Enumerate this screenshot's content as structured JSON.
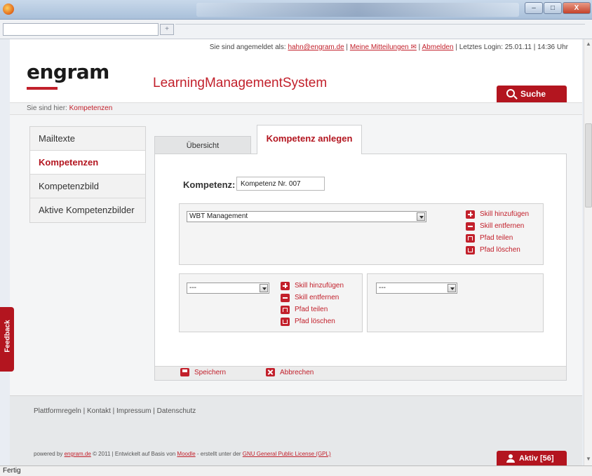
{
  "window": {
    "minimize": "–",
    "maximize": "□",
    "close": "X",
    "new_tab": "+"
  },
  "header": {
    "logged_in_prefix": "Sie sind angemeldet als: ",
    "user_email": "hahn@engram.de",
    "sep1": " | ",
    "messages": "Meine Mitteilungen ✉",
    "sep2": " | ",
    "logout": "Abmelden",
    "last_login": " | Letztes Login: 25.01.11 | 14:36 Uhr",
    "logo": "engram",
    "app_title": "LearningManagementSystem",
    "search_label": "Suche"
  },
  "breadcrumb": {
    "prefix": "Sie sind hier: ",
    "current": "Kompetenzen"
  },
  "sidebar": {
    "items": [
      {
        "label": "Mailtexte"
      },
      {
        "label": "Kompetenzen"
      },
      {
        "label": "Kompetenzbild"
      },
      {
        "label": "Aktive Kompetenzbilder"
      }
    ]
  },
  "feedback_label": "Feedback",
  "tabs": {
    "overview": "Übersicht",
    "create": "Kompetenz anlegen"
  },
  "form": {
    "kompetenz_label": "Kompetenz:",
    "kompetenz_value": "Kompetenz Nr. 007",
    "select_main": "WBT Management",
    "select_left": "---",
    "select_right": "---"
  },
  "actions": {
    "add_skill": "Skill hinzufügen",
    "remove_skill": "Skill entfernen",
    "split_path": "Pfad teilen",
    "delete_path": "Pfad löschen"
  },
  "panel_footer": {
    "save": "Speichern",
    "cancel": "Abbrechen"
  },
  "footer": {
    "links": "Plattformregeln | Kontakt | Impressum | Datenschutz",
    "powered_prefix": "powered by ",
    "powered_link": "engram.de",
    "powered_mid": " © 2011 | Entwickelt auf Basis von ",
    "moodle": "Moodle",
    "powered_mid2": " - erstellt unter der ",
    "gpl": "GNU General Public License (GPL)",
    "aktiv": "Aktiv [56]"
  },
  "status": "Fertig",
  "colors": {
    "brand_red": "#b3151f",
    "link_red": "#c2202b"
  }
}
